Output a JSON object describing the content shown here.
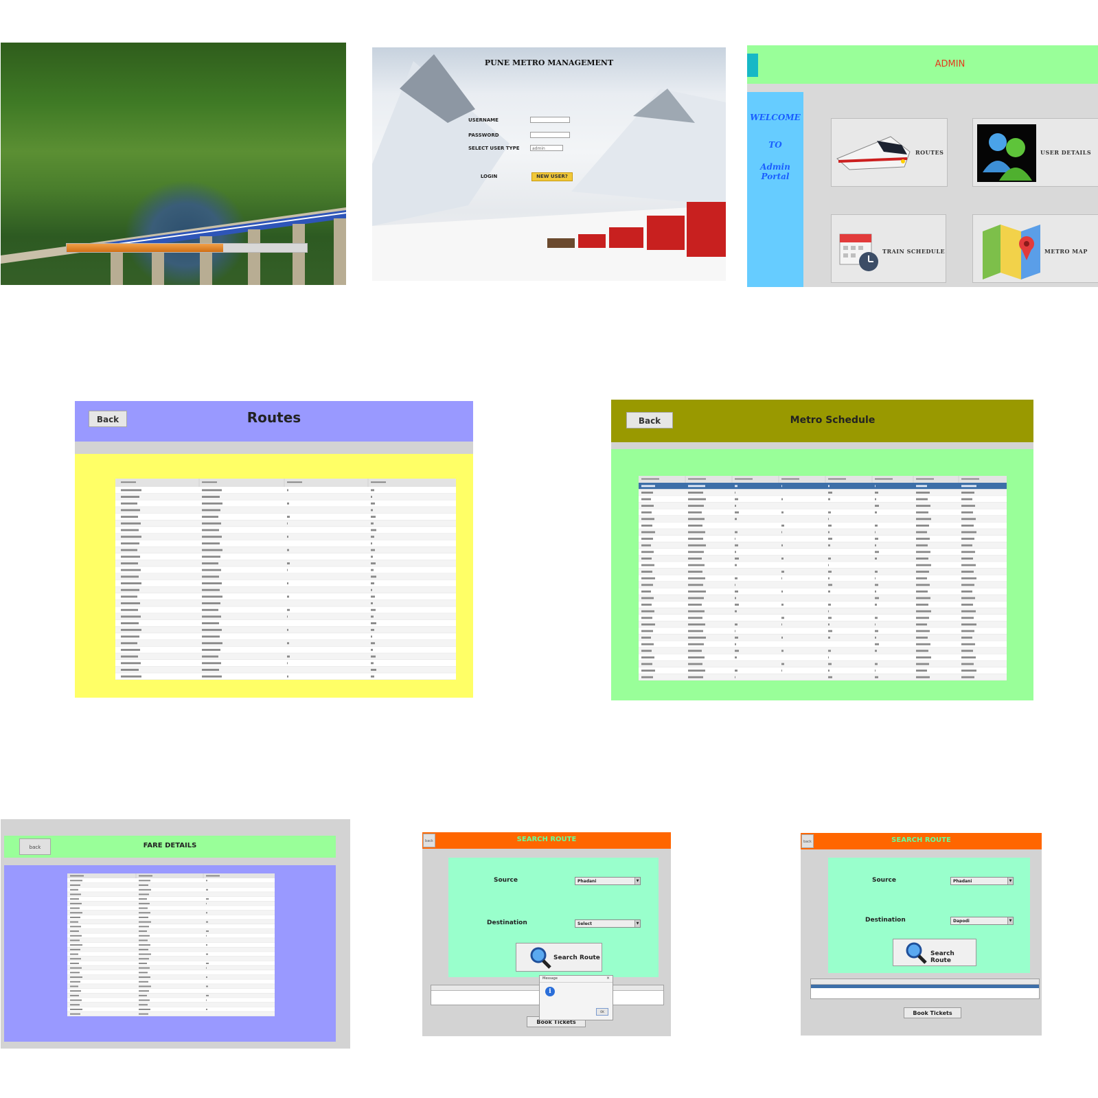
{
  "panel_login": {
    "title": "PUNE METRO MANAGEMENT",
    "username_label": "USERNAME",
    "password_label": "PASSWORD",
    "user_type_label": "SELECT USER TYPE",
    "username_value": "",
    "password_value": "",
    "user_type_value": "admin",
    "login_label": "LOGIN",
    "new_user_label": "NEW USER?"
  },
  "panel_splash": {
    "progress": 0.65
  },
  "panel_admin": {
    "title": "ADMIN",
    "welcome_lines": [
      "WELCOME",
      "TO",
      "Admin Portal"
    ],
    "tiles": [
      {
        "label": "ROUTES",
        "icon": "train-icon"
      },
      {
        "label": "USER DETAILS",
        "icon": "users-icon"
      },
      {
        "label": "TRAIN SCHEDULE",
        "icon": "calendar-clock-icon"
      },
      {
        "label": "METRO MAP",
        "icon": "map-pin-icon"
      }
    ]
  },
  "panel_routes": {
    "title": "Routes",
    "back_label": "Back",
    "rows": 29
  },
  "panel_schedule": {
    "title": "Metro Schedule",
    "back_label": "Back",
    "rows": 30
  },
  "panel_fare": {
    "title": "FARE DETAILS",
    "back_label": "back",
    "rows": 30
  },
  "panel_search_1": {
    "title": "SEARCH ROUTE",
    "back_label": "back",
    "source_label": "Source",
    "destination_label": "Destination",
    "source_value": "Phadani",
    "destination_value": "Select",
    "search_label": "Search Route",
    "book_label": "Book Tickets",
    "dialog_title": "Message",
    "dialog_ok": "OK"
  },
  "panel_search_2": {
    "title": "SEARCH ROUTE",
    "back_label": "back",
    "source_label": "Source",
    "destination_label": "Destination",
    "source_value": "Phadani",
    "destination_value": "Dapodi",
    "search_label": "Search Route",
    "book_label": "Book Tickets"
  },
  "colors": {
    "routes_header": "#9999ff",
    "routes_body": "#ffff66",
    "schedule_header": "#999900",
    "schedule_body": "#99ff99",
    "search_header": "#ff6600",
    "search_body": "#99ffcc",
    "admin_title": "#e43a1c"
  }
}
